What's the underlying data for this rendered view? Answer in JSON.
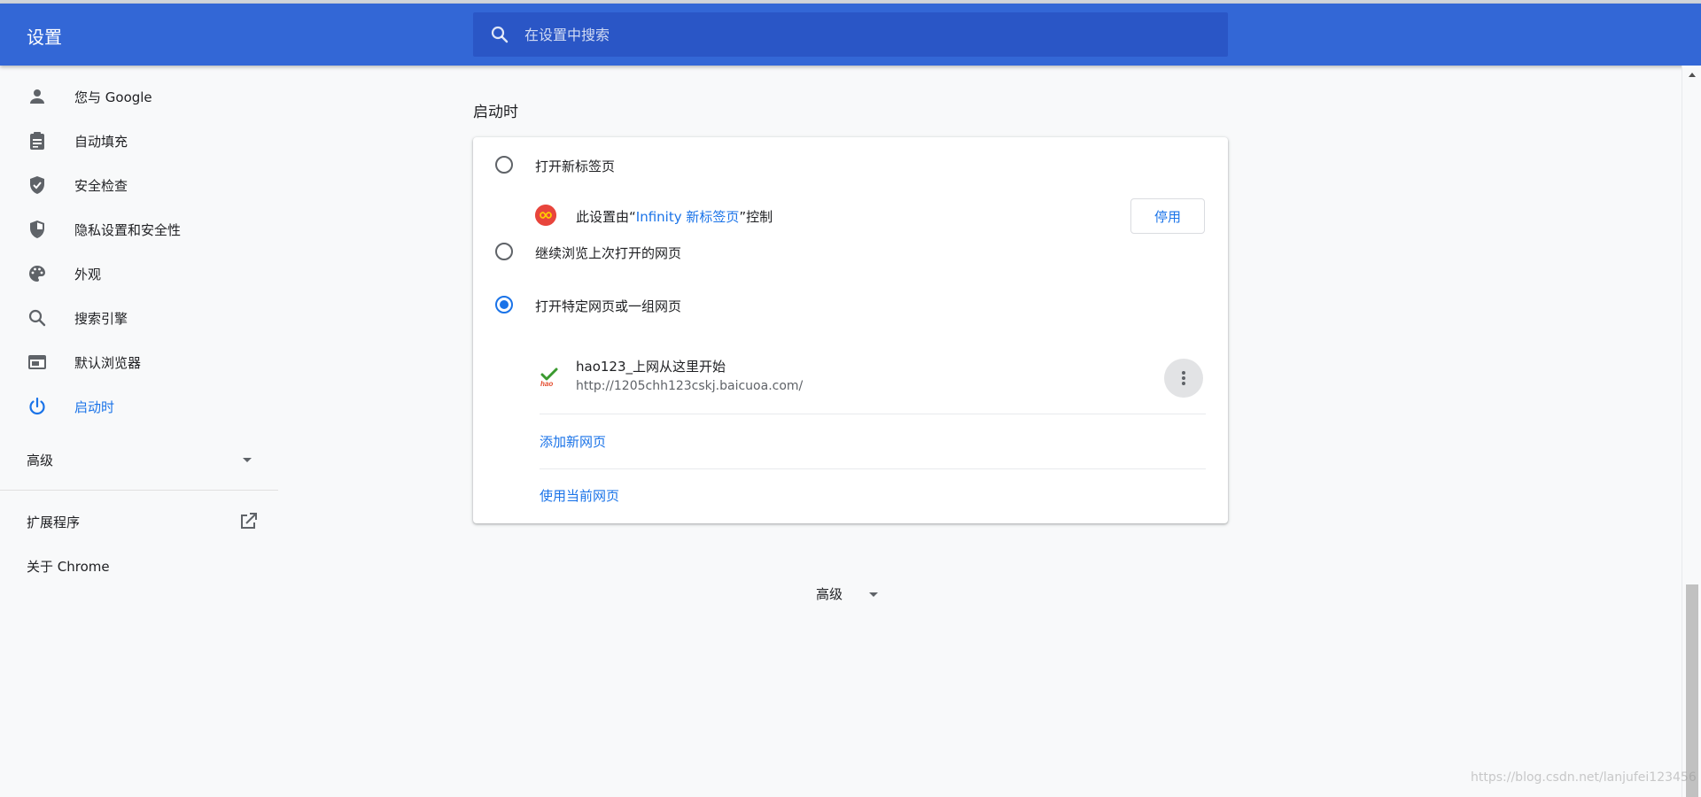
{
  "header": {
    "title": "设置",
    "search_placeholder": "在设置中搜索"
  },
  "sidebar": {
    "items": [
      {
        "label": "您与 Google",
        "icon": "person-icon"
      },
      {
        "label": "自动填充",
        "icon": "clipboard-icon"
      },
      {
        "label": "安全检查",
        "icon": "shield-check-icon"
      },
      {
        "label": "隐私设置和安全性",
        "icon": "shield-half-icon"
      },
      {
        "label": "外观",
        "icon": "palette-icon"
      },
      {
        "label": "搜索引擎",
        "icon": "search-icon"
      },
      {
        "label": "默认浏览器",
        "icon": "browser-window-icon"
      },
      {
        "label": "启动时",
        "icon": "power-icon",
        "active": true
      }
    ],
    "advanced_label": "高级",
    "extensions_label": "扩展程序",
    "about_label": "关于 Chrome"
  },
  "main": {
    "section_title": "启动时",
    "options": [
      {
        "label": "打开新标签页",
        "checked": false
      },
      {
        "label": "继续浏览上次打开的网页",
        "checked": false
      },
      {
        "label": "打开特定网页或一组网页",
        "checked": true
      }
    ],
    "extension_notice": {
      "prefix": "此设置由“",
      "link": "Infinity 新标签页",
      "suffix": "”控制",
      "button": "停用"
    },
    "startup_page": {
      "title": "hao123_上网从这里开始",
      "url": "http://1205chh123cskj.baicuoa.com/"
    },
    "add_page_label": "添加新网页",
    "use_current_label": "使用当前网页",
    "advanced_label": "高级"
  },
  "watermark": "https://blog.csdn.net/lanjufei123456",
  "colors": {
    "header_bg": "#3367d6",
    "search_bg": "#2a56c6",
    "accent": "#1a73e8"
  }
}
